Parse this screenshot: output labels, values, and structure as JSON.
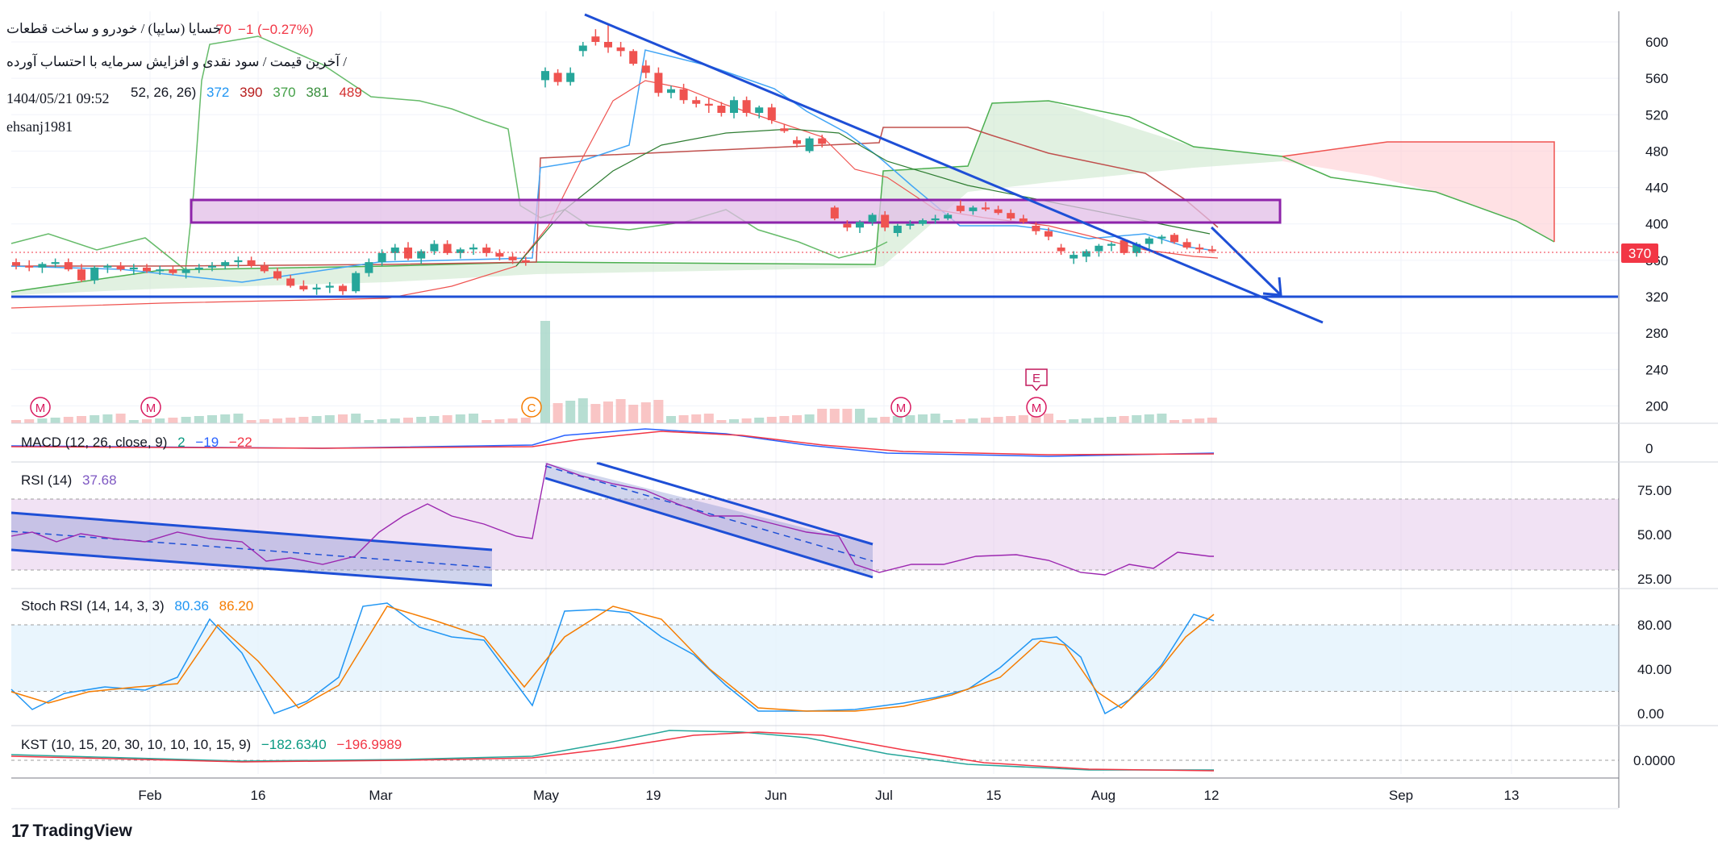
{
  "header": {
    "symbol_line": "خسایا (سایپا) / خودرو و ساخت قطعات",
    "price_change_value": "70",
    "price_change": "−1 (−0.27%)",
    "description_line": "آخرین قیمت / سود نقدی و افزایش سرمایه با احتساب آورده /",
    "timestamp": "1404/05/21 09:52",
    "author": "ehsanj1981",
    "ichimoku_params": "52, 26, 26)",
    "ichimoku_values": [
      "372",
      "390",
      "370",
      "381",
      "489"
    ],
    "ichimoku_colors": [
      "#2196f3",
      "#b71c1c",
      "#43a047",
      "#388e3c",
      "#d32f2f"
    ]
  },
  "panes": {
    "macd": {
      "label": "MACD (12, 26, close, 9)",
      "v1": "2",
      "v2": "−19",
      "v3": "−22",
      "c1": "#089981",
      "c2": "#2962ff",
      "c3": "#f23645"
    },
    "rsi": {
      "label": "RSI (14)",
      "value": "37.68",
      "color": "#7e57c2"
    },
    "stoch": {
      "label": "Stoch RSI (14, 14, 3, 3)",
      "k": "80.36",
      "d": "86.20",
      "kcolor": "#2196f3",
      "dcolor": "#f57c00"
    },
    "kst": {
      "label": "KST (10, 15, 20, 30, 10, 10, 10, 15, 9)",
      "v1": "−182.6340",
      "v2": "−196.9989",
      "c1": "#089981",
      "c2": "#f23645"
    }
  },
  "price_axis": {
    "ticks": [
      "600",
      "560",
      "520",
      "480",
      "440",
      "400",
      "360",
      "320",
      "280",
      "240",
      "200"
    ],
    "last_price": "370"
  },
  "rsi_axis": {
    "ticks": [
      "75.00",
      "50.00",
      "25.00"
    ]
  },
  "stoch_axis": {
    "ticks": [
      "80.00",
      "40.00",
      "0.00"
    ]
  },
  "macd_axis": {
    "ticks": [
      "0"
    ]
  },
  "kst_axis": {
    "ticks": [
      "0.0000"
    ]
  },
  "time_axis": {
    "labels": [
      "Feb",
      "16",
      "Mar",
      "May",
      "19",
      "Jun",
      "Jul",
      "15",
      "Aug",
      "12",
      "Sep",
      "13"
    ]
  },
  "markers": [
    "M",
    "M",
    "C",
    "M",
    "M",
    "E"
  ],
  "brand": {
    "name": "TradingView"
  },
  "chart_data": {
    "type": "candlestick",
    "price_ylim": [
      160,
      630
    ],
    "candles": [
      {
        "o": 358,
        "h": 362,
        "l": 350,
        "c": 354
      },
      {
        "o": 354,
        "h": 360,
        "l": 348,
        "c": 352
      },
      {
        "o": 352,
        "h": 358,
        "l": 346,
        "c": 356
      },
      {
        "o": 356,
        "h": 362,
        "l": 352,
        "c": 358
      },
      {
        "o": 358,
        "h": 362,
        "l": 348,
        "c": 350
      },
      {
        "o": 350,
        "h": 356,
        "l": 336,
        "c": 338
      },
      {
        "o": 338,
        "h": 354,
        "l": 334,
        "c": 352
      },
      {
        "o": 352,
        "h": 356,
        "l": 346,
        "c": 354
      },
      {
        "o": 354,
        "h": 358,
        "l": 348,
        "c": 350
      },
      {
        "o": 350,
        "h": 356,
        "l": 344,
        "c": 352
      },
      {
        "o": 352,
        "h": 356,
        "l": 346,
        "c": 348
      },
      {
        "o": 348,
        "h": 354,
        "l": 344,
        "c": 350
      },
      {
        "o": 350,
        "h": 354,
        "l": 344,
        "c": 346
      },
      {
        "o": 346,
        "h": 352,
        "l": 340,
        "c": 350
      },
      {
        "o": 350,
        "h": 356,
        "l": 346,
        "c": 352
      },
      {
        "o": 352,
        "h": 358,
        "l": 348,
        "c": 354
      },
      {
        "o": 354,
        "h": 360,
        "l": 350,
        "c": 358
      },
      {
        "o": 358,
        "h": 364,
        "l": 352,
        "c": 360
      },
      {
        "o": 360,
        "h": 364,
        "l": 352,
        "c": 354
      },
      {
        "o": 354,
        "h": 358,
        "l": 346,
        "c": 348
      },
      {
        "o": 348,
        "h": 352,
        "l": 338,
        "c": 340
      },
      {
        "o": 340,
        "h": 344,
        "l": 330,
        "c": 332
      },
      {
        "o": 332,
        "h": 338,
        "l": 326,
        "c": 328
      },
      {
        "o": 328,
        "h": 334,
        "l": 322,
        "c": 330
      },
      {
        "o": 330,
        "h": 336,
        "l": 324,
        "c": 332
      },
      {
        "o": 332,
        "h": 334,
        "l": 322,
        "c": 326
      },
      {
        "o": 326,
        "h": 348,
        "l": 324,
        "c": 346
      },
      {
        "o": 346,
        "h": 362,
        "l": 342,
        "c": 358
      },
      {
        "o": 358,
        "h": 372,
        "l": 354,
        "c": 368
      },
      {
        "o": 368,
        "h": 378,
        "l": 360,
        "c": 374
      },
      {
        "o": 374,
        "h": 380,
        "l": 360,
        "c": 362
      },
      {
        "o": 362,
        "h": 372,
        "l": 356,
        "c": 370
      },
      {
        "o": 370,
        "h": 382,
        "l": 366,
        "c": 378
      },
      {
        "o": 378,
        "h": 382,
        "l": 366,
        "c": 368
      },
      {
        "o": 368,
        "h": 374,
        "l": 362,
        "c": 372
      },
      {
        "o": 372,
        "h": 378,
        "l": 366,
        "c": 374
      },
      {
        "o": 374,
        "h": 378,
        "l": 364,
        "c": 368
      },
      {
        "o": 368,
        "h": 372,
        "l": 360,
        "c": 364
      },
      {
        "o": 364,
        "h": 368,
        "l": 356,
        "c": 360
      },
      {
        "o": 360,
        "h": 364,
        "l": 354,
        "c": 358
      },
      {
        "o": 558,
        "h": 572,
        "l": 550,
        "c": 568
      },
      {
        "o": 566,
        "h": 570,
        "l": 552,
        "c": 556
      },
      {
        "o": 556,
        "h": 572,
        "l": 552,
        "c": 566
      },
      {
        "o": 590,
        "h": 600,
        "l": 584,
        "c": 596
      },
      {
        "o": 606,
        "h": 614,
        "l": 596,
        "c": 600
      },
      {
        "o": 600,
        "h": 620,
        "l": 588,
        "c": 594
      },
      {
        "o": 594,
        "h": 600,
        "l": 584,
        "c": 590
      },
      {
        "o": 590,
        "h": 592,
        "l": 574,
        "c": 576
      },
      {
        "o": 574,
        "h": 580,
        "l": 560,
        "c": 566
      },
      {
        "o": 566,
        "h": 572,
        "l": 540,
        "c": 544
      },
      {
        "o": 544,
        "h": 552,
        "l": 538,
        "c": 548
      },
      {
        "o": 548,
        "h": 554,
        "l": 532,
        "c": 536
      },
      {
        "o": 536,
        "h": 540,
        "l": 528,
        "c": 532
      },
      {
        "o": 532,
        "h": 538,
        "l": 522,
        "c": 530
      },
      {
        "o": 530,
        "h": 534,
        "l": 518,
        "c": 522
      },
      {
        "o": 522,
        "h": 540,
        "l": 516,
        "c": 536
      },
      {
        "o": 536,
        "h": 540,
        "l": 518,
        "c": 522
      },
      {
        "o": 522,
        "h": 530,
        "l": 516,
        "c": 528
      },
      {
        "o": 528,
        "h": 532,
        "l": 510,
        "c": 514
      },
      {
        "o": 505,
        "h": 510,
        "l": 500,
        "c": 502
      },
      {
        "o": 492,
        "h": 496,
        "l": 484,
        "c": 488
      },
      {
        "o": 480,
        "h": 496,
        "l": 478,
        "c": 494
      },
      {
        "o": 494,
        "h": 498,
        "l": 484,
        "c": 488
      },
      {
        "o": 418,
        "h": 420,
        "l": 404,
        "c": 406
      },
      {
        "o": 400,
        "h": 404,
        "l": 392,
        "c": 396
      },
      {
        "o": 396,
        "h": 404,
        "l": 390,
        "c": 402
      },
      {
        "o": 402,
        "h": 412,
        "l": 398,
        "c": 410
      },
      {
        "o": 410,
        "h": 414,
        "l": 392,
        "c": 396
      },
      {
        "o": 390,
        "h": 400,
        "l": 386,
        "c": 398
      },
      {
        "o": 398,
        "h": 404,
        "l": 394,
        "c": 400
      },
      {
        "o": 400,
        "h": 406,
        "l": 398,
        "c": 404
      },
      {
        "o": 404,
        "h": 410,
        "l": 400,
        "c": 406
      },
      {
        "o": 406,
        "h": 412,
        "l": 404,
        "c": 410
      },
      {
        "o": 420,
        "h": 426,
        "l": 412,
        "c": 414
      },
      {
        "o": 414,
        "h": 420,
        "l": 410,
        "c": 418
      },
      {
        "o": 418,
        "h": 424,
        "l": 414,
        "c": 416
      },
      {
        "o": 416,
        "h": 420,
        "l": 410,
        "c": 412
      },
      {
        "o": 412,
        "h": 416,
        "l": 404,
        "c": 406
      },
      {
        "o": 406,
        "h": 410,
        "l": 400,
        "c": 402
      },
      {
        "o": 398,
        "h": 402,
        "l": 388,
        "c": 392
      },
      {
        "o": 392,
        "h": 396,
        "l": 382,
        "c": 386
      },
      {
        "o": 374,
        "h": 378,
        "l": 366,
        "c": 370
      },
      {
        "o": 362,
        "h": 370,
        "l": 356,
        "c": 366
      },
      {
        "o": 364,
        "h": 372,
        "l": 358,
        "c": 370
      },
      {
        "o": 370,
        "h": 378,
        "l": 364,
        "c": 376
      },
      {
        "o": 376,
        "h": 380,
        "l": 370,
        "c": 378
      },
      {
        "o": 382,
        "h": 384,
        "l": 366,
        "c": 368
      },
      {
        "o": 368,
        "h": 380,
        "l": 364,
        "c": 378
      },
      {
        "o": 378,
        "h": 386,
        "l": 372,
        "c": 384
      },
      {
        "o": 384,
        "h": 388,
        "l": 378,
        "c": 386
      },
      {
        "o": 388,
        "h": 390,
        "l": 378,
        "c": 380
      },
      {
        "o": 380,
        "h": 384,
        "l": 372,
        "c": 374
      },
      {
        "o": 374,
        "h": 378,
        "l": 368,
        "c": 372
      },
      {
        "o": 372,
        "h": 376,
        "l": 368,
        "c": 370
      }
    ],
    "horizontal_support": 322,
    "resistance_box": [
      402,
      428
    ],
    "last_price": 370
  }
}
